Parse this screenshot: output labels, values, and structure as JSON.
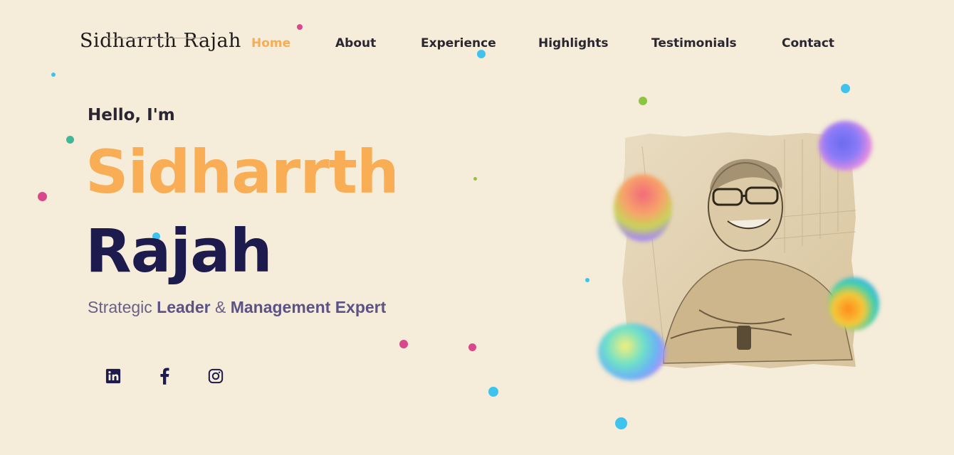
{
  "header": {
    "logo_text": "Sidharrth Rajah",
    "nav": [
      {
        "label": "Home",
        "active": true
      },
      {
        "label": "About",
        "active": false
      },
      {
        "label": "Experience",
        "active": false
      },
      {
        "label": "Highlights",
        "active": false
      },
      {
        "label": "Testimonials",
        "active": false
      },
      {
        "label": "Contact",
        "active": false
      }
    ]
  },
  "hero": {
    "greeting": "Hello, I'm",
    "first_name": "Sidharrth",
    "last_name": "Rajah",
    "tagline": {
      "part1": "Strategic ",
      "bold1": "Leader",
      "part2": " & ",
      "bold2": "Management Expert"
    }
  },
  "social": [
    {
      "name": "linkedin-icon"
    },
    {
      "name": "facebook-icon"
    },
    {
      "name": "instagram-icon"
    }
  ],
  "colors": {
    "background": "#f5ecd9",
    "accent_orange": "#f9ad55",
    "navy": "#1d1b4d",
    "tagline": "#6a5f87"
  }
}
